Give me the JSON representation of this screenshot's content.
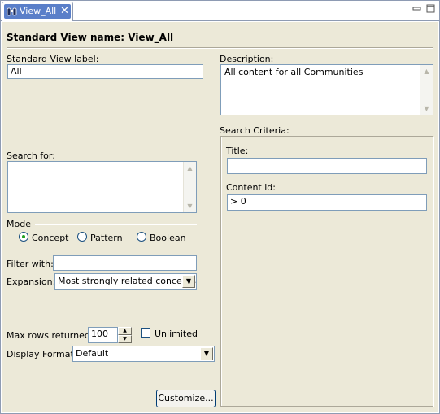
{
  "tab": {
    "label": "View_All",
    "close_glyph": "✕",
    "icon": "binoculars-icon"
  },
  "window_buttons": {
    "minimize": "minimize-icon",
    "maximize": "maximize-icon"
  },
  "form": {
    "title": "Standard View name: View_All",
    "label_field": {
      "label": "Standard View label:",
      "value": "All"
    },
    "description": {
      "label": "Description:",
      "value": "All content for all Communities"
    },
    "search_for": {
      "label": "Search for:",
      "value": ""
    },
    "mode": {
      "label": "Mode",
      "options": [
        "Concept",
        "Pattern",
        "Boolean"
      ],
      "selected": "Concept"
    },
    "filter_with": {
      "label": "Filter with:",
      "value": ""
    },
    "expansion": {
      "label": "Expansion:",
      "value": "Most strongly related concepts"
    },
    "max_rows": {
      "label": "Max rows returned:",
      "value": "100"
    },
    "unlimited": {
      "label": "Unlimited",
      "checked": false
    },
    "display_format": {
      "label": "Display Format:",
      "value": "Default"
    },
    "customize_button": "Customize...",
    "search_criteria": {
      "label": "Search Criteria:",
      "title": {
        "label": "Title:",
        "value": ""
      },
      "content_id": {
        "label": "Content id:",
        "value": "> 0"
      }
    }
  }
}
